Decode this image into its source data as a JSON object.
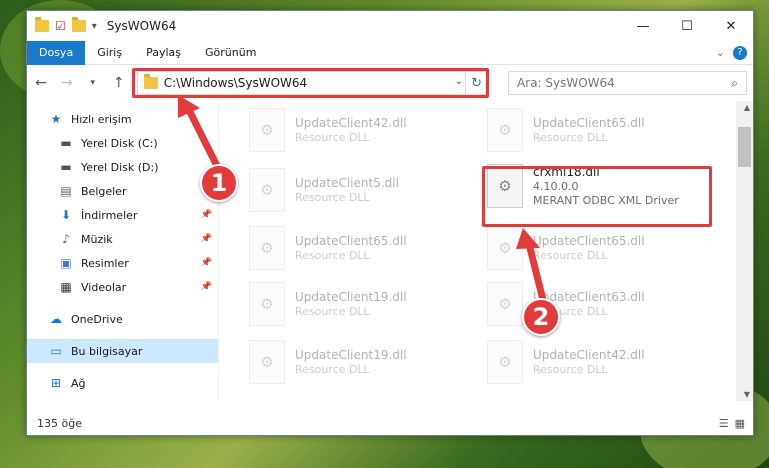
{
  "window": {
    "title": "SysWOW64",
    "minimize": "—",
    "maximize": "☐",
    "close": "✕"
  },
  "ribbon": {
    "tabs": [
      "Dosya",
      "Giriş",
      "Paylaş",
      "Görünüm"
    ]
  },
  "address": {
    "path": "C:\\Windows\\SysWOW64",
    "search_placeholder": "Ara: SysWOW64"
  },
  "sidebar": {
    "items": [
      {
        "label": "Hızlı erişim",
        "icon": "star-icon"
      },
      {
        "label": "Yerel Disk (C:)",
        "icon": "drive-icon"
      },
      {
        "label": "Yerel Disk (D:)",
        "icon": "drive-icon"
      },
      {
        "label": "Belgeler",
        "icon": "documents-icon"
      },
      {
        "label": "İndirmeler",
        "icon": "download-icon"
      },
      {
        "label": "Müzik",
        "icon": "music-icon"
      },
      {
        "label": "Resimler",
        "icon": "pictures-icon"
      },
      {
        "label": "Videolar",
        "icon": "video-icon"
      },
      {
        "label": "OneDrive",
        "icon": "cloud-icon"
      },
      {
        "label": "Bu bilgisayar",
        "icon": "computer-icon"
      },
      {
        "label": "Ağ",
        "icon": "network-icon"
      }
    ]
  },
  "files": [
    {
      "name": "UpdateClient42.dll",
      "desc": "Resource DLL"
    },
    {
      "name": "UpdateClient65.dll",
      "desc": "Resource DLL"
    },
    {
      "name": "UpdateClient5.dll",
      "desc": "Resource DLL"
    },
    {
      "name": "crxml18.dll",
      "version": "4.10.0.0",
      "desc": "MERANT ODBC XML Driver"
    },
    {
      "name": "UpdateClient65.dll",
      "desc": "Resource DLL"
    },
    {
      "name": "UpdateClient65.dll",
      "desc": "Resource DLL"
    },
    {
      "name": "UpdateClient19.dll",
      "desc": "Resource DLL"
    },
    {
      "name": "UpdateClient63.dll",
      "desc": "Resource DLL"
    },
    {
      "name": "UpdateClient19.dll",
      "desc": "Resource DLL"
    },
    {
      "name": "UpdateClient42.dll",
      "desc": "Resource DLL"
    }
  ],
  "status": {
    "count": "135 öğe"
  },
  "annotations": {
    "badge1": "1",
    "badge2": "2",
    "color": "#e33b3b"
  }
}
